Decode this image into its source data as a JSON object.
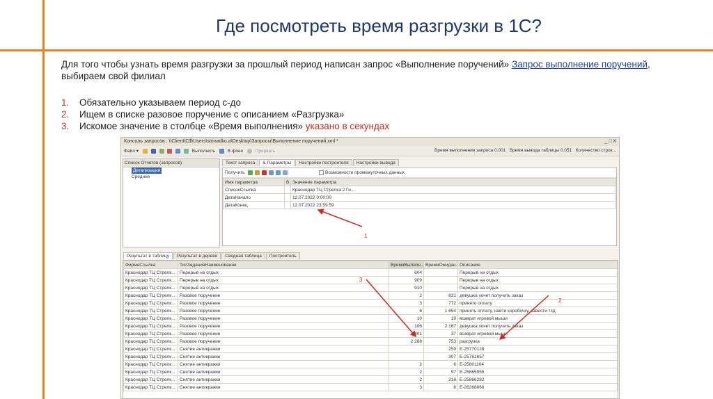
{
  "slide": {
    "title": "Где посмотреть время разгрузки в 1С?",
    "intro_text": "Для того чтобы узнать время разгрузки за прошлый период написан запрос «Выполнение поручений» ",
    "intro_link": "Запрос выполнение поручений",
    "intro_tail": ", выбираем свой филиал",
    "steps": [
      {
        "num": "1.",
        "text": "Обязательно указываем период с-до",
        "highlight": ""
      },
      {
        "num": "2.",
        "text": "Ищем в списке разовое поручение с описанием «Разгрузка»",
        "highlight": ""
      },
      {
        "num": "3.",
        "text": "Искомое значение в столбце «Время выполнения» ",
        "highlight": "указано в секундах"
      }
    ]
  },
  "window": {
    "title": "Консоль запросов : \\\\Client\\C$\\Users\\strinadko.a\\Desktop\\Запросы\\Выполнение поручений.xml *",
    "controls": "_ □ X",
    "toolbar": {
      "file": "Файл ▾",
      "run": "Выполнить",
      "background": "В фоне",
      "stop": "Прервать"
    },
    "status": {
      "query_time": "Время выполнения запроса 0.001",
      "output_time": "Время вывода таблицы 0.051",
      "rows": "Количество строк..."
    },
    "left_panel": {
      "header": "Список Отчетов (запросов)",
      "items": [
        "Детализация",
        "Средние"
      ]
    },
    "top_tabs": [
      "Текст запроса",
      "& Параметры",
      "Настройки построителя",
      "Настройки вывода"
    ],
    "params": {
      "get_label": "Получить",
      "intermediate": "Возможности промежуточных данных",
      "headers": [
        "Имя параметра",
        "В.",
        "Значение параметра"
      ],
      "rows": [
        [
          "СписокСсылка",
          "Краснодар ТЦ Стрелка 2 Ги..."
        ],
        [
          "ДатаНачало",
          "12.07.2022 0:00:00"
        ],
        [
          "ДатаКонец",
          "12.07.2022 23:59:59"
        ]
      ]
    },
    "result_tabs": [
      "Результат в таблицу",
      "Результат в дерево",
      "Сводная таблица",
      "Построитель"
    ],
    "result": {
      "headers": [
        "ФирмаСсылка",
        "ТипЗаданияНаименование",
        "ВремяВыполн...",
        "ВремяОжидан...",
        "Описание"
      ],
      "rows": [
        [
          "Краснодар ТЦ Стрелк...",
          "Перерыв на отдых",
          "604",
          "",
          "Перерыв на отдых"
        ],
        [
          "Краснодар ТЦ Стрелк...",
          "Перерыв на отдых",
          "909",
          "",
          "Перерыв на отдых"
        ],
        [
          "Краснодар ТЦ Стрелк...",
          "Перерыв на отдых",
          "910",
          "",
          "Перерыв на отдых"
        ],
        [
          "Краснодар ТЦ Стрелк...",
          "Разовое поручение",
          "2",
          "831",
          "девушка хочет получить заказ"
        ],
        [
          "Краснодар ТЦ Стрелк...",
          "Разовое поручение",
          "3",
          "772",
          "принято оплату"
        ],
        [
          "Краснодар ТЦ Стрелк...",
          "Разовое поручение",
          "6",
          "1 654",
          "принять оплату, найти коробочку, завести тсд"
        ],
        [
          "Краснодар ТЦ Стрелк...",
          "Разовое поручение",
          "10",
          "19",
          "возврат игровой мыши"
        ],
        [
          "Краснодар ТЦ Стрелк...",
          "Разовое поручение",
          "106",
          "2 167",
          "девушка хочет получить заказ"
        ],
        [
          "Краснодар ТЦ Стрелк...",
          "Разовое поручение",
          "401",
          "37",
          "возврат игровой мыши"
        ],
        [
          "Краснодар ТЦ Стрелк...",
          "Разовое поручение",
          "2 288",
          "753",
          "разгрузка"
        ],
        [
          "Краснодар ТЦ Стрелк...",
          "Снятие антикражки",
          "",
          "259",
          "E-25770128"
        ],
        [
          "Краснодар ТЦ Стрелк...",
          "Снятие антикражки",
          "",
          "307",
          "E-25761657"
        ],
        [
          "Краснодар ТЦ Стрелк...",
          "Снятие антикражки",
          "2",
          "6",
          "E-25801104"
        ],
        [
          "Краснодар ТЦ Стрелк...",
          "Снятие антикражки",
          "2",
          "97",
          "E-25865955"
        ],
        [
          "Краснодар ТЦ Стрелк...",
          "Снятие антикражки",
          "2",
          "218",
          "E-25866282"
        ],
        [
          "Краснодар ТЦ Стрелк...",
          "Снятие антикражки",
          "3",
          "6",
          "E-26268060"
        ]
      ]
    }
  },
  "annotations": {
    "a1": "1",
    "a2": "2",
    "a3": "3",
    "color": "#d4281c"
  }
}
